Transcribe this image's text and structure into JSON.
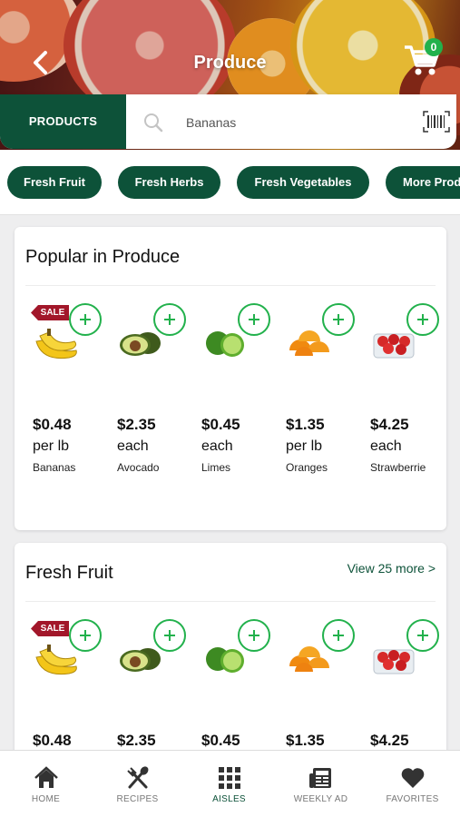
{
  "header": {
    "title": "Produce",
    "cart_count": "0"
  },
  "search": {
    "tab_label": "PRODUCTS",
    "value": "Bananas"
  },
  "categories": [
    "Fresh Fruit",
    "Fresh Herbs",
    "Fresh Vegetables",
    "More Prod"
  ],
  "sections": [
    {
      "title": "Popular in Produce",
      "view_more": "",
      "products": [
        {
          "price": "$0.48",
          "unit": "per lb",
          "name": "Bananas",
          "sale": "SALE",
          "icon": "banana"
        },
        {
          "price": "$2.35",
          "unit": "each",
          "name": "Avocado",
          "sale": "",
          "icon": "avocado"
        },
        {
          "price": "$0.45",
          "unit": "each",
          "name": "Limes",
          "sale": "",
          "icon": "lime"
        },
        {
          "price": "$1.35",
          "unit": "per lb",
          "name": "Oranges",
          "sale": "",
          "icon": "orange"
        },
        {
          "price": "$4.25",
          "unit": "each",
          "name": "Strawberrie",
          "sale": "",
          "icon": "strawberry"
        }
      ]
    },
    {
      "title": "Fresh Fruit",
      "view_more": "View 25 more >",
      "products": [
        {
          "price": "$0.48",
          "sale": "SALE",
          "icon": "banana"
        },
        {
          "price": "$2.35",
          "sale": "",
          "icon": "avocado"
        },
        {
          "price": "$0.45",
          "sale": "",
          "icon": "lime"
        },
        {
          "price": "$1.35",
          "sale": "",
          "icon": "orange"
        },
        {
          "price": "$4.25",
          "sale": "",
          "icon": "strawberry"
        }
      ]
    }
  ],
  "bottom_nav": [
    {
      "label": "HOME",
      "icon": "home-icon"
    },
    {
      "label": "RECIPES",
      "icon": "utensils-icon"
    },
    {
      "label": "AISLES",
      "icon": "grid-icon",
      "active": true
    },
    {
      "label": "WEEKLY AD",
      "icon": "newspaper-icon"
    },
    {
      "label": "FAVORITES",
      "icon": "heart-icon"
    }
  ],
  "colors": {
    "brand_green": "#0d5239",
    "add_green": "#22b14c",
    "sale_red": "#a2172a"
  }
}
